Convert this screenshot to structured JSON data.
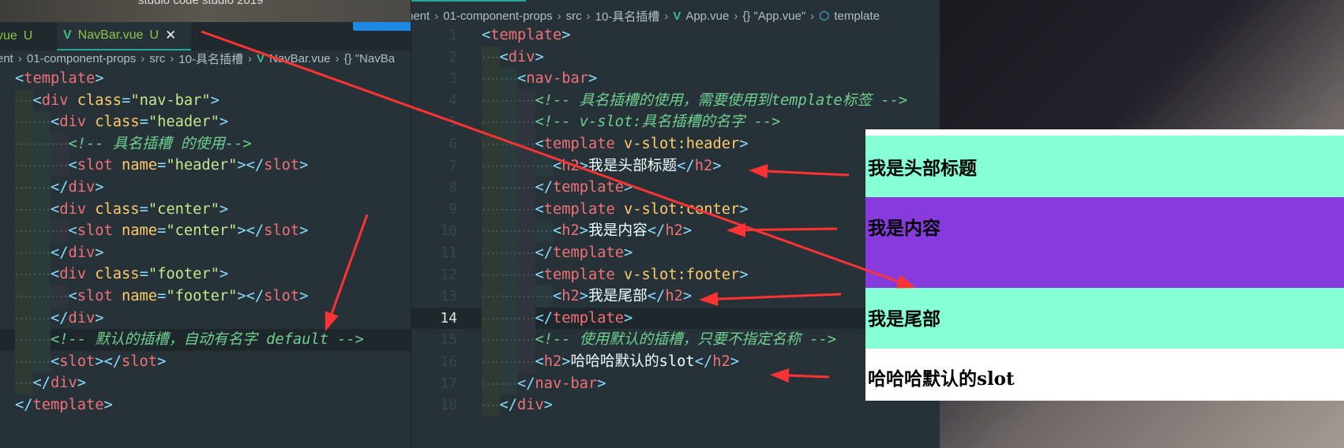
{
  "window": {
    "title": "studio code studio 2019"
  },
  "left": {
    "tabs": [
      {
        "label": "vue",
        "status": "U",
        "active": false
      },
      {
        "label": "NavBar.vue",
        "status": "U",
        "active": true
      }
    ],
    "breadcrumb": [
      "ent",
      "01-component-props",
      "src",
      "10-具名插槽",
      "NavBar.vue",
      "{} \"NavBa"
    ],
    "current_line": 13,
    "lines": [
      {
        "i": 0,
        "t": [
          [
            "b",
            "<"
          ],
          [
            "tg",
            "template"
          ],
          [
            "b",
            ">"
          ]
        ]
      },
      {
        "i": 1,
        "t": [
          [
            "b",
            "<"
          ],
          [
            "tg",
            "div"
          ],
          [
            "tx",
            " "
          ],
          [
            "at",
            "class"
          ],
          [
            "eq",
            "="
          ],
          [
            "s",
            "\"nav-bar\""
          ],
          [
            "b",
            ">"
          ]
        ]
      },
      {
        "i": 2,
        "t": [
          [
            "b",
            "<"
          ],
          [
            "tg",
            "div"
          ],
          [
            "tx",
            " "
          ],
          [
            "at",
            "class"
          ],
          [
            "eq",
            "="
          ],
          [
            "s",
            "\"header\""
          ],
          [
            "b",
            ">"
          ]
        ]
      },
      {
        "i": 3,
        "t": [
          [
            "c",
            "<!-- 具名插槽 的使用-->"
          ]
        ]
      },
      {
        "i": 3,
        "t": [
          [
            "b",
            "<"
          ],
          [
            "tg",
            "slot"
          ],
          [
            "tx",
            " "
          ],
          [
            "at",
            "name"
          ],
          [
            "eq",
            "="
          ],
          [
            "s",
            "\"header\""
          ],
          [
            "b",
            "></"
          ],
          [
            "tg",
            "slot"
          ],
          [
            "b",
            ">"
          ]
        ]
      },
      {
        "i": 2,
        "t": [
          [
            "b",
            "</"
          ],
          [
            "tg",
            "div"
          ],
          [
            "b",
            ">"
          ]
        ]
      },
      {
        "i": 2,
        "t": [
          [
            "b",
            "<"
          ],
          [
            "tg",
            "div"
          ],
          [
            "tx",
            " "
          ],
          [
            "at",
            "class"
          ],
          [
            "eq",
            "="
          ],
          [
            "s",
            "\"center\""
          ],
          [
            "b",
            ">"
          ]
        ]
      },
      {
        "i": 3,
        "t": [
          [
            "b",
            "<"
          ],
          [
            "tg",
            "slot"
          ],
          [
            "tx",
            " "
          ],
          [
            "at",
            "name"
          ],
          [
            "eq",
            "="
          ],
          [
            "s",
            "\"center\""
          ],
          [
            "b",
            "></"
          ],
          [
            "tg",
            "slot"
          ],
          [
            "b",
            ">"
          ]
        ]
      },
      {
        "i": 2,
        "t": [
          [
            "b",
            "</"
          ],
          [
            "tg",
            "div"
          ],
          [
            "b",
            ">"
          ]
        ]
      },
      {
        "i": 2,
        "t": [
          [
            "b",
            "<"
          ],
          [
            "tg",
            "div"
          ],
          [
            "tx",
            " "
          ],
          [
            "at",
            "class"
          ],
          [
            "eq",
            "="
          ],
          [
            "s",
            "\"footer\""
          ],
          [
            "b",
            ">"
          ]
        ]
      },
      {
        "i": 3,
        "t": [
          [
            "b",
            "<"
          ],
          [
            "tg",
            "slot"
          ],
          [
            "tx",
            " "
          ],
          [
            "at",
            "name"
          ],
          [
            "eq",
            "="
          ],
          [
            "s",
            "\"footer\""
          ],
          [
            "b",
            "></"
          ],
          [
            "tg",
            "slot"
          ],
          [
            "b",
            ">"
          ]
        ]
      },
      {
        "i": 2,
        "t": [
          [
            "b",
            "</"
          ],
          [
            "tg",
            "div"
          ],
          [
            "b",
            ">"
          ]
        ]
      },
      {
        "i": 2,
        "t": [
          [
            "c",
            "<!-- 默认的插槽，自动有名字 default -->"
          ]
        ]
      },
      {
        "i": 2,
        "t": [
          [
            "b",
            "<"
          ],
          [
            "tg",
            "slot"
          ],
          [
            "b",
            "></"
          ],
          [
            "tg",
            "slot"
          ],
          [
            "b",
            ">"
          ]
        ]
      },
      {
        "i": 1,
        "t": [
          [
            "b",
            "</"
          ],
          [
            "tg",
            "div"
          ],
          [
            "b",
            ">"
          ]
        ]
      },
      {
        "i": 0,
        "t": [
          [
            "b",
            "</"
          ],
          [
            "tg",
            "template"
          ],
          [
            "b",
            ">"
          ]
        ]
      }
    ]
  },
  "right": {
    "breadcrumb": [
      "nent",
      "01-component-props",
      "src",
      "10-具名插槽",
      "App.vue",
      "{} \"App.vue\"",
      "template"
    ],
    "current_line": 14,
    "lines": [
      {
        "n": "1",
        "i": 0,
        "t": [
          [
            "b",
            "<"
          ],
          [
            "tg",
            "template"
          ],
          [
            "b",
            ">"
          ]
        ]
      },
      {
        "n": "2",
        "i": 1,
        "t": [
          [
            "b",
            "<"
          ],
          [
            "tg",
            "div"
          ],
          [
            "b",
            ">"
          ]
        ]
      },
      {
        "n": "3",
        "i": 2,
        "t": [
          [
            "b",
            "<"
          ],
          [
            "tg",
            "nav-bar"
          ],
          [
            "b",
            ">"
          ]
        ]
      },
      {
        "n": "4",
        "i": 3,
        "t": [
          [
            "c",
            "<!-- 具名插槽的使用，需要使用到template标签 -->"
          ]
        ]
      },
      {
        "n": "5",
        "i": 3,
        "t": [
          [
            "c",
            "<!-- v-slot:具名插槽的名字 -->"
          ]
        ]
      },
      {
        "n": "6",
        "i": 3,
        "t": [
          [
            "b",
            "<"
          ],
          [
            "tg",
            "template"
          ],
          [
            "tx",
            " "
          ],
          [
            "at",
            "v-slot:header"
          ],
          [
            "b",
            ">"
          ]
        ]
      },
      {
        "n": "7",
        "i": 4,
        "t": [
          [
            "b",
            "<"
          ],
          [
            "tg",
            "h2"
          ],
          [
            "b",
            ">"
          ],
          [
            "tx",
            "我是头部标题"
          ],
          [
            "b",
            "</"
          ],
          [
            "tg",
            "h2"
          ],
          [
            "b",
            ">"
          ]
        ]
      },
      {
        "n": "8",
        "i": 3,
        "t": [
          [
            "b",
            "</"
          ],
          [
            "tg",
            "template"
          ],
          [
            "b",
            ">"
          ]
        ]
      },
      {
        "n": "9",
        "i": 3,
        "t": [
          [
            "b",
            "<"
          ],
          [
            "tg",
            "template"
          ],
          [
            "tx",
            " "
          ],
          [
            "at",
            "v-slot:center"
          ],
          [
            "b",
            ">"
          ]
        ]
      },
      {
        "n": "10",
        "i": 4,
        "t": [
          [
            "b",
            "<"
          ],
          [
            "tg",
            "h2"
          ],
          [
            "b",
            ">"
          ],
          [
            "tx",
            "我是内容"
          ],
          [
            "b",
            "</"
          ],
          [
            "tg",
            "h2"
          ],
          [
            "b",
            ">"
          ]
        ]
      },
      {
        "n": "11",
        "i": 3,
        "t": [
          [
            "b",
            "</"
          ],
          [
            "tg",
            "template"
          ],
          [
            "b",
            ">"
          ]
        ]
      },
      {
        "n": "12",
        "i": 3,
        "t": [
          [
            "b",
            "<"
          ],
          [
            "tg",
            "template"
          ],
          [
            "tx",
            " "
          ],
          [
            "at",
            "v-slot:footer"
          ],
          [
            "b",
            ">"
          ]
        ]
      },
      {
        "n": "13",
        "i": 4,
        "t": [
          [
            "b",
            "<"
          ],
          [
            "tg",
            "h2"
          ],
          [
            "b",
            ">"
          ],
          [
            "tx",
            "我是尾部"
          ],
          [
            "b",
            "</"
          ],
          [
            "tg",
            "h2"
          ],
          [
            "b",
            ">"
          ]
        ]
      },
      {
        "n": "14",
        "i": 3,
        "t": [
          [
            "b",
            "</"
          ],
          [
            "tg",
            "template"
          ],
          [
            "b",
            ">"
          ]
        ]
      },
      {
        "n": "15",
        "i": 3,
        "t": [
          [
            "c",
            "<!-- 使用默认的插槽，只要不指定名称 -->"
          ]
        ]
      },
      {
        "n": "16",
        "i": 3,
        "t": [
          [
            "b",
            "<"
          ],
          [
            "tg",
            "h2"
          ],
          [
            "b",
            ">"
          ],
          [
            "tx",
            "哈哈哈默认的slot"
          ],
          [
            "b",
            "</"
          ],
          [
            "tg",
            "h2"
          ],
          [
            "b",
            ">"
          ]
        ]
      },
      {
        "n": "17",
        "i": 2,
        "t": [
          [
            "b",
            "</"
          ],
          [
            "tg",
            "nav-bar"
          ],
          [
            "b",
            ">"
          ]
        ]
      },
      {
        "n": "18",
        "i": 1,
        "t": [
          [
            "b",
            "</"
          ],
          [
            "tg",
            "div"
          ],
          [
            "b",
            ">"
          ]
        ]
      }
    ]
  },
  "preview": {
    "header": "我是头部标题",
    "center": "我是内容",
    "footer": "我是尾部",
    "default": "哈哈哈默认的slot",
    "colors": {
      "header": "#86ffd6",
      "center": "#883bdc",
      "footer": "#86ffd6",
      "default": "#ffffff"
    }
  },
  "annotation_color": "#ff3333"
}
